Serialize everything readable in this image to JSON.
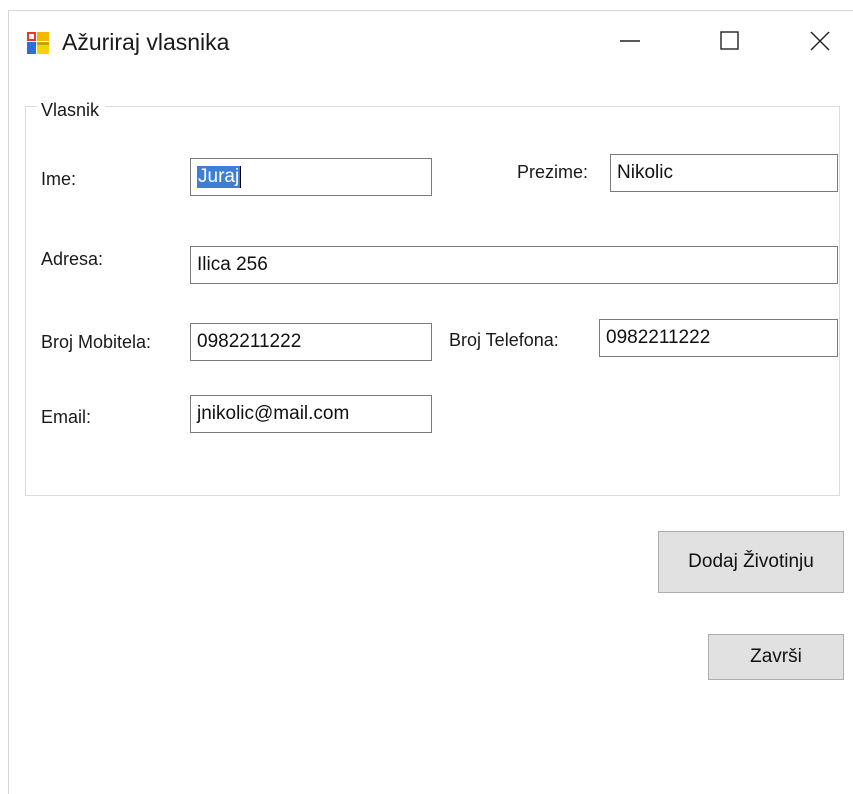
{
  "window": {
    "title": "Ažuriraj vlasnika"
  },
  "group": {
    "legend": "Vlasnik"
  },
  "form": {
    "ime_label": "Ime:",
    "ime_value": "Juraj",
    "prezime_label": "Prezime:",
    "prezime_value": "Nikolic",
    "adresa_label": "Adresa:",
    "adresa_value": "Ilica 256",
    "mobitel_label": "Broj Mobitela:",
    "mobitel_value": "0982211222",
    "telefon_label": "Broj Telefona:",
    "telefon_value": "0982211222",
    "email_label": "Email:",
    "email_value": "jnikolic@mail.com"
  },
  "buttons": {
    "add_animal": "Dodaj Životinju",
    "finish": "Završi"
  },
  "icons": {
    "app": "windows-form-icon",
    "minimize": "minimize-icon",
    "maximize": "maximize-icon",
    "close": "close-icon"
  }
}
